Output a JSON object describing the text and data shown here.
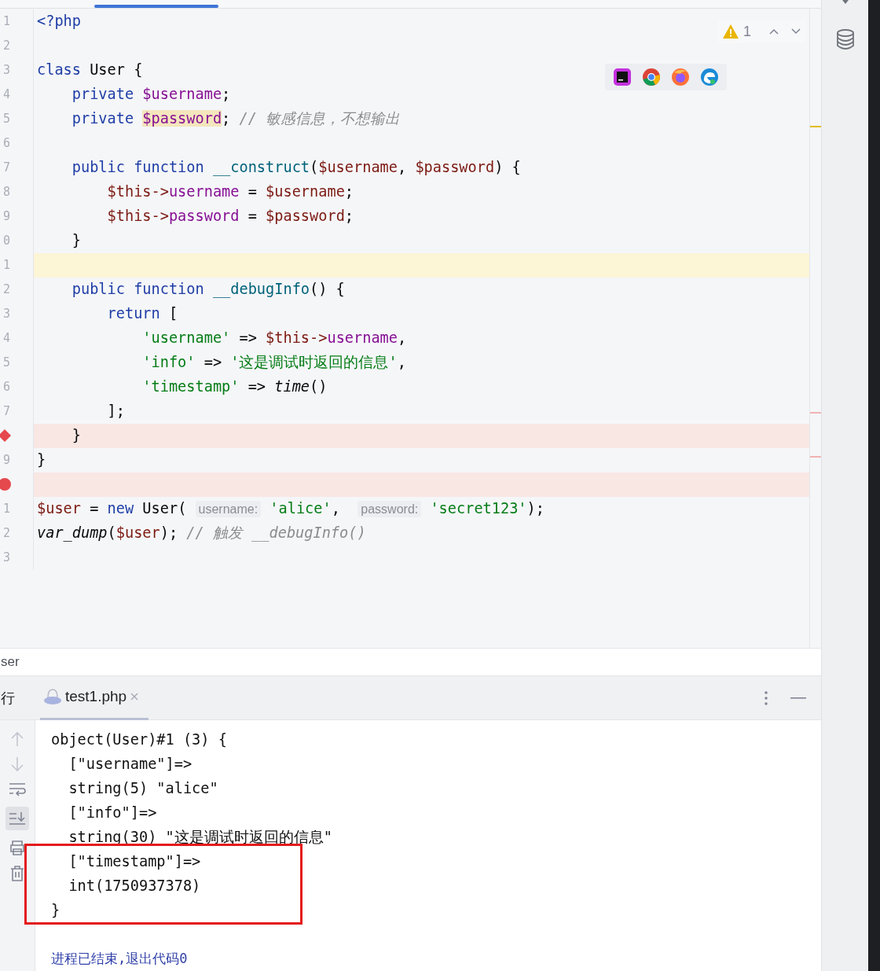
{
  "editor": {
    "inspection": {
      "warnings": "1"
    },
    "lines": [
      {
        "number": "1",
        "kind": "line",
        "tokens": [
          {
            "kind": "kw",
            "text": "<?php"
          }
        ]
      },
      {
        "number": "2",
        "kind": "line"
      },
      {
        "number": "3",
        "kind": "line",
        "tokens": [
          {
            "kind": "kw",
            "text": "class "
          },
          {
            "kind": "plain",
            "text": "User {"
          }
        ]
      },
      {
        "number": "4",
        "kind": "line",
        "tokens": [
          {
            "kind": "kw",
            "text": "    private "
          },
          {
            "kind": "field",
            "text": "$username"
          },
          {
            "kind": "plain",
            "text": ";"
          }
        ]
      },
      {
        "number": "5",
        "kind": "line",
        "tokens": [
          {
            "kind": "kw",
            "text": "    private "
          },
          {
            "kind": "mark",
            "text": "$password"
          },
          {
            "kind": "plain",
            "text": "; "
          },
          {
            "kind": "comment",
            "text": "// 敏感信息，不想输出"
          }
        ]
      },
      {
        "number": "6",
        "kind": "line"
      },
      {
        "number": "7",
        "kind": "line",
        "tokens": [
          {
            "kind": "kw",
            "text": "    public function "
          },
          {
            "kind": "func",
            "text": "__construct"
          },
          {
            "kind": "plain",
            "text": "("
          },
          {
            "kind": "var",
            "text": "$username"
          },
          {
            "kind": "plain",
            "text": ", "
          },
          {
            "kind": "var",
            "text": "$password"
          },
          {
            "kind": "plain",
            "text": ") {"
          }
        ]
      },
      {
        "number": "8",
        "kind": "line",
        "tokens": [
          {
            "kind": "var",
            "text": "        $this->"
          },
          {
            "kind": "field",
            "text": "username"
          },
          {
            "kind": "plain",
            "text": " = "
          },
          {
            "kind": "var",
            "text": "$username"
          },
          {
            "kind": "plain",
            "text": ";"
          }
        ]
      },
      {
        "number": "9",
        "kind": "line",
        "tokens": [
          {
            "kind": "var",
            "text": "        $this->"
          },
          {
            "kind": "field",
            "text": "password"
          },
          {
            "kind": "plain",
            "text": " = "
          },
          {
            "kind": "var",
            "text": "$password"
          },
          {
            "kind": "plain",
            "text": ";"
          }
        ]
      },
      {
        "number": "0",
        "kind": "line",
        "tokens": [
          {
            "kind": "plain",
            "text": "    }"
          }
        ]
      },
      {
        "number": "1",
        "kind": "current-line"
      },
      {
        "number": "2",
        "kind": "line",
        "tokens": [
          {
            "kind": "kw",
            "text": "    public function "
          },
          {
            "kind": "func",
            "text": "__debugInfo"
          },
          {
            "kind": "plain",
            "text": "() {"
          }
        ]
      },
      {
        "number": "3",
        "kind": "line",
        "tokens": [
          {
            "kind": "kw",
            "text": "        return"
          },
          {
            "kind": "plain",
            "text": " ["
          }
        ]
      },
      {
        "number": "4",
        "kind": "line",
        "tokens": [
          {
            "kind": "str",
            "text": "            'username'"
          },
          {
            "kind": "plain",
            "text": " => "
          },
          {
            "kind": "var",
            "text": "$this->"
          },
          {
            "kind": "field",
            "text": "username"
          },
          {
            "kind": "plain",
            "text": ","
          }
        ]
      },
      {
        "number": "5",
        "kind": "line",
        "tokens": [
          {
            "kind": "str",
            "text": "            'info'"
          },
          {
            "kind": "plain",
            "text": " => "
          },
          {
            "kind": "str",
            "text": "'这是调试时返回的信息'"
          },
          {
            "kind": "plain",
            "text": ","
          }
        ]
      },
      {
        "number": "6",
        "kind": "line",
        "tokens": [
          {
            "kind": "str",
            "text": "            'timestamp'"
          },
          {
            "kind": "plain",
            "text": " => "
          },
          {
            "kind": "italic",
            "text": "time"
          },
          {
            "kind": "plain",
            "text": "()"
          }
        ]
      },
      {
        "number": "7",
        "kind": "line",
        "tokens": [
          {
            "kind": "plain",
            "text": "        ];"
          }
        ]
      },
      {
        "kind": "method-breakpoint",
        "tokens": [
          {
            "kind": "plain",
            "text": "    }"
          }
        ]
      },
      {
        "number": "9",
        "kind": "line",
        "tokens": [
          {
            "kind": "plain",
            "text": "}"
          }
        ]
      },
      {
        "kind": "breakpoint"
      },
      {
        "number": "1",
        "kind": "line",
        "tokens": [
          {
            "kind": "var",
            "text": "$user"
          },
          {
            "kind": "plain",
            "text": " = "
          },
          {
            "kind": "kw",
            "text": "new"
          },
          {
            "kind": "plain",
            "text": " User( "
          },
          {
            "kind": "hint",
            "text": "username:"
          },
          {
            "kind": "str",
            "text": " 'alice'"
          },
          {
            "kind": "plain",
            "text": ",  "
          },
          {
            "kind": "hint",
            "text": "password:"
          },
          {
            "kind": "str",
            "text": " 'secret123'"
          },
          {
            "kind": "plain",
            "text": ");"
          }
        ]
      },
      {
        "number": "2",
        "kind": "line",
        "tokens": [
          {
            "kind": "italic",
            "text": "var_dump"
          },
          {
            "kind": "plain",
            "text": "("
          },
          {
            "kind": "var",
            "text": "$user"
          },
          {
            "kind": "plain",
            "text": "); "
          },
          {
            "kind": "comment",
            "text": "// 触发 __debugInfo()"
          }
        ]
      },
      {
        "number": "3",
        "kind": "line"
      }
    ]
  },
  "breadcrumb": "ser",
  "run_panel": {
    "title": "行",
    "tabs": [
      {
        "label": "test1.php",
        "selected": true
      }
    ],
    "output": [
      "object(User)#1 (3) {",
      "  [\"username\"]=>",
      "  string(5) \"alice\"",
      "  [\"info\"]=>",
      "  string(30) \"这是调试时返回的信息\"",
      "  [\"timestamp\"]=>",
      "  int(1750937378)",
      "}"
    ],
    "exit_message": "进程已结束,退出代码0"
  }
}
